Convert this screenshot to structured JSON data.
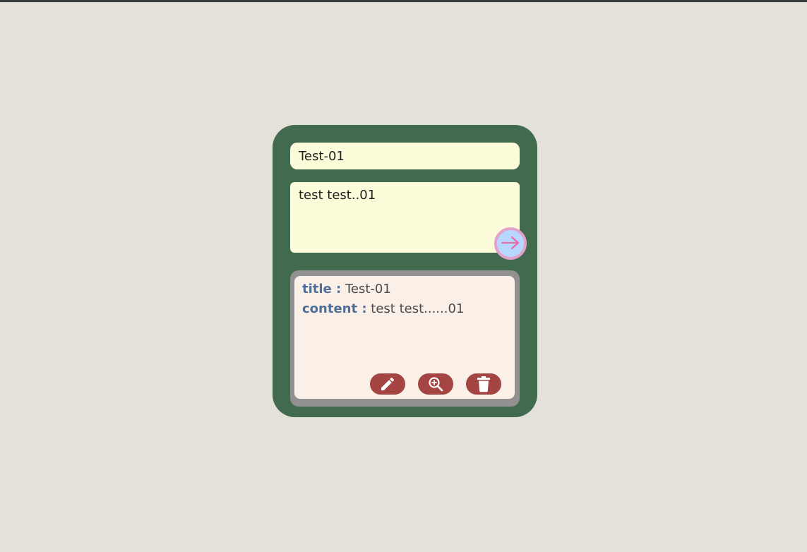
{
  "form": {
    "title_value": "Test-01",
    "content_value": "test test..01",
    "submit_icon": "arrow-right-icon"
  },
  "note": {
    "title_label": "title :",
    "title_value": "Test-01",
    "content_label": "content :",
    "content_value": "test test......01",
    "actions": [
      {
        "name": "edit",
        "icon": "pencil-icon"
      },
      {
        "name": "view",
        "icon": "zoom-in-icon"
      },
      {
        "name": "delete",
        "icon": "trash-icon"
      }
    ]
  },
  "colors": {
    "background": "#e4e1db",
    "card": "#426a4f",
    "input": "#fcfcda",
    "note_frame": "#929090",
    "note": "#fbf0e7",
    "label": "#4f6e9a",
    "action_button": "#a44543",
    "submit_fill": "#b7d7ff",
    "submit_border": "#e3a2c9"
  }
}
